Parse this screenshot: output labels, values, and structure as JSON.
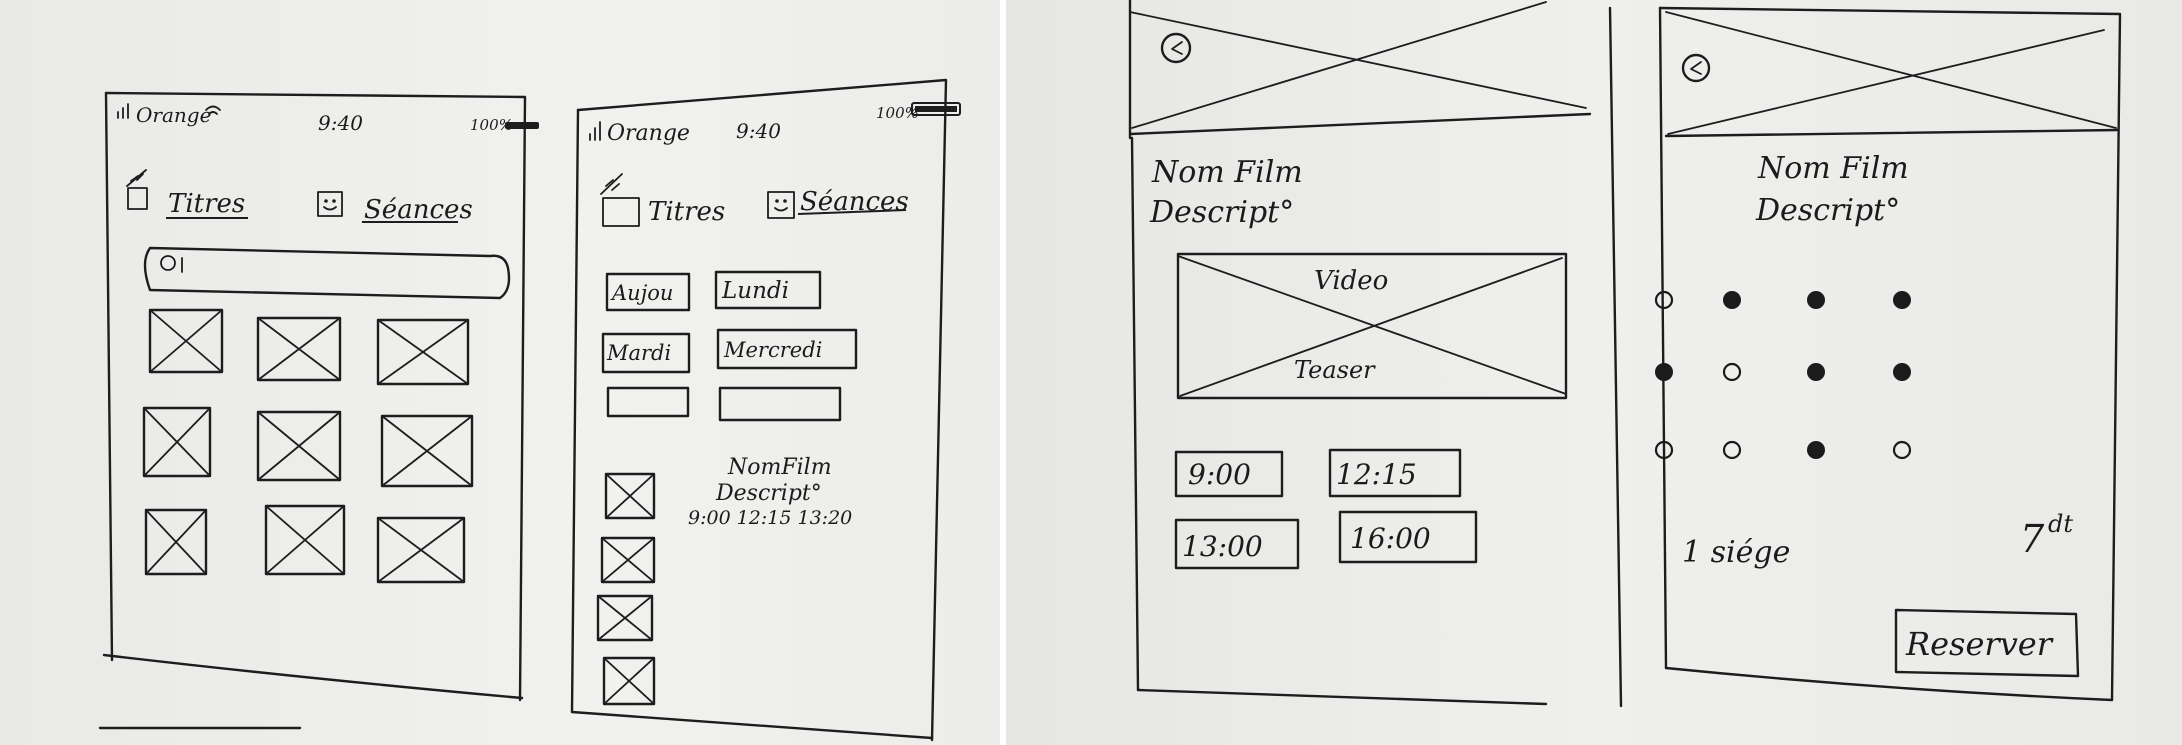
{
  "screen_list": {
    "status": {
      "carrier": "Orange",
      "time": "9:40",
      "battery": "100%"
    },
    "tabs": [
      {
        "label": "Titres"
      },
      {
        "label": "Séances"
      }
    ],
    "search": {
      "icon": "search-icon"
    },
    "grid": {
      "rows": 3,
      "cols": 3
    }
  },
  "screen_seances": {
    "status": {
      "carrier": "Orange",
      "time": "9:40",
      "battery": "100%"
    },
    "tabs": [
      {
        "label": "Titres"
      },
      {
        "label": "Séances"
      }
    ],
    "days": [
      "Aujou",
      "Lundi",
      "Mardi",
      "Mercredi",
      "",
      ""
    ],
    "film": {
      "name": "NomFilm",
      "description": "Descript°",
      "times": "9:00    12:15   13:20"
    }
  },
  "screen_detail": {
    "back_icon": "back-arrow-icon",
    "film": {
      "name": "Nom Film",
      "description": "Descript°"
    },
    "video": {
      "top_label": "Video",
      "bottom_label": "Teaser"
    },
    "times": [
      "9:00",
      "12:15",
      "13:00",
      "16:00"
    ]
  },
  "screen_booking": {
    "back_icon": "back-arrow-icon",
    "film": {
      "name": "Nom Film",
      "description": "Descript°"
    },
    "seats": [
      [
        "empty",
        "filled",
        "filled",
        "filled"
      ],
      [
        "filled",
        "empty",
        "filled",
        "filled"
      ],
      [
        "empty",
        "empty",
        "filled",
        "empty"
      ]
    ],
    "seat_count": "1 siége",
    "price": "7",
    "price_unit": "dt",
    "reserve_label": "Reserver"
  }
}
